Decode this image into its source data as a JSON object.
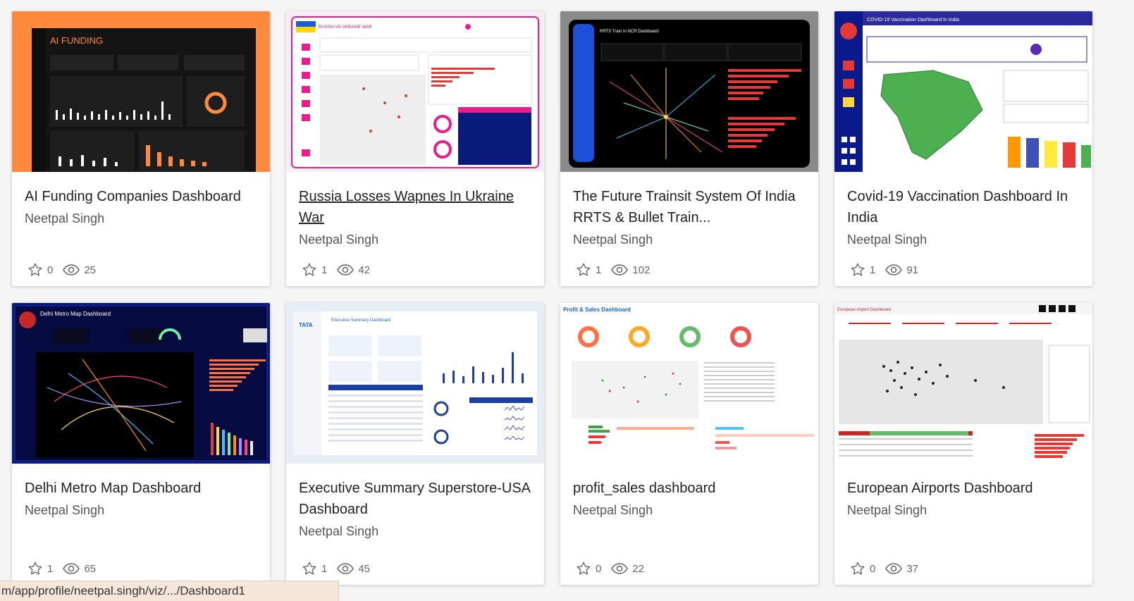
{
  "cards": [
    {
      "title": "AI Funding Companies Dashboard",
      "author": "Neetpal Singh",
      "favorites": "0",
      "views": "25",
      "thumb_heading": "AI FUNDING"
    },
    {
      "title": "Russia Losses Wapnes In Ukraine War",
      "author": "Neetpal Singh",
      "favorites": "1",
      "views": "42",
      "thumb_heading": "RUSSIA VS UKRAINE WAR"
    },
    {
      "title": "The Future Trainsit System Of India RRTS & Bullet Train...",
      "author": "Neetpal Singh",
      "favorites": "1",
      "views": "102",
      "thumb_heading": "RRTS Train In NCR Dashboard"
    },
    {
      "title": "Covid-19 Vaccination Dashboard In India",
      "author": "Neetpal Singh",
      "favorites": "1",
      "views": "91",
      "thumb_heading": "COVID-19 Vaccination Dashboard In India"
    },
    {
      "title": "Delhi Metro Map Dashboard",
      "author": "Neetpal Singh",
      "favorites": "1",
      "views": "65",
      "thumb_heading": "Delhi Metro Map Dashboard"
    },
    {
      "title": "Executive Summary Superstore-USA Dashboard",
      "author": "Neetpal Singh",
      "favorites": "1",
      "views": "45",
      "thumb_heading": "Executive Summary Dashboard"
    },
    {
      "title": "profit_sales dashboard",
      "author": "Neetpal Singh",
      "favorites": "0",
      "views": "22",
      "thumb_heading": "Profit & Sales Dashboard"
    },
    {
      "title": "European Airports Dashboard",
      "author": "Neetpal Singh",
      "favorites": "0",
      "views": "37",
      "thumb_heading": "European Airport Dashboard"
    }
  ],
  "status_url": "m/app/profile/neetpal.singh/viz/.../Dashboard1",
  "colors": {
    "accent_orange": "#ff8a3d",
    "dark_bg": "#1b1b1b",
    "navy": "#0a1a7a"
  }
}
